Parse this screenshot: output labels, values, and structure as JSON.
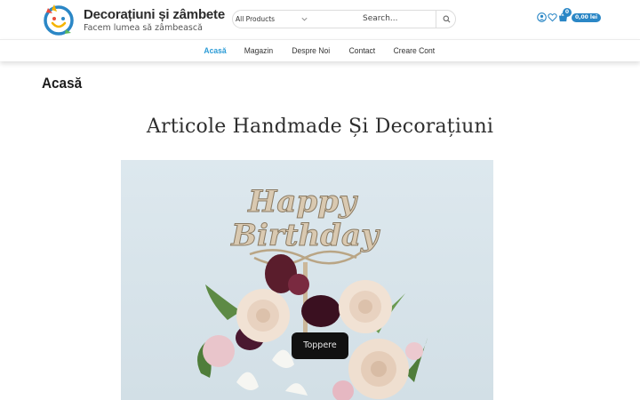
{
  "header": {
    "site_title": "Decorațiuni și zâmbete",
    "tagline": "Facem lumea să zâmbească",
    "logo_icon": "smiley-logo-icon"
  },
  "search": {
    "category_selected": "All Products",
    "placeholder": "Search..."
  },
  "header_icons": {
    "account_icon": "user-circle-icon",
    "wishlist_icon": "heart-icon",
    "cart_icon": "basket-icon",
    "cart_count": "0",
    "cart_total": "0,00 lei"
  },
  "nav": {
    "items": [
      {
        "label": "Acasă",
        "active": true
      },
      {
        "label": "Magazin"
      },
      {
        "label": "Despre Noi"
      },
      {
        "label": "Contact"
      },
      {
        "label": "Creare Cont"
      }
    ]
  },
  "page": {
    "title": "Acasă"
  },
  "hero": {
    "heading": "Articole Handmade Și Decorațiuni",
    "image_topper_text": "Happy Birthday",
    "image_label": "Toppere"
  },
  "colors": {
    "accent": "#2b9bd6",
    "cart_badge": "#2b87c6",
    "label_bg": "#111111"
  }
}
